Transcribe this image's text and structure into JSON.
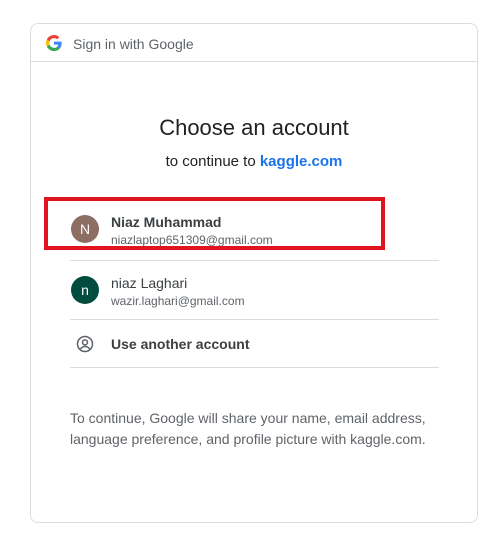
{
  "header": {
    "title": "Sign in with Google",
    "logo_icon": "google-g-icon"
  },
  "main": {
    "title": "Choose an account",
    "subtitle_prefix": "to continue to ",
    "subtitle_link": "kaggle.com"
  },
  "accounts": [
    {
      "initial": "N",
      "name": "Niaz Muhammad",
      "email": "niazlaptop651309@gmail.com",
      "avatar_color": "#8d6e63"
    },
    {
      "initial": "n",
      "name": "niaz Laghari",
      "email": "wazir.laghari@gmail.com",
      "avatar_color": "#004d40"
    }
  ],
  "another_account": {
    "label": "Use another account",
    "icon": "account-circle-icon"
  },
  "footer": {
    "text": "To continue, Google will share your name, email address, language preference, and profile picture with kaggle.com."
  },
  "colors": {
    "link": "#1a73e8",
    "highlight_box": "#e0141e",
    "border": "#dadce0"
  }
}
